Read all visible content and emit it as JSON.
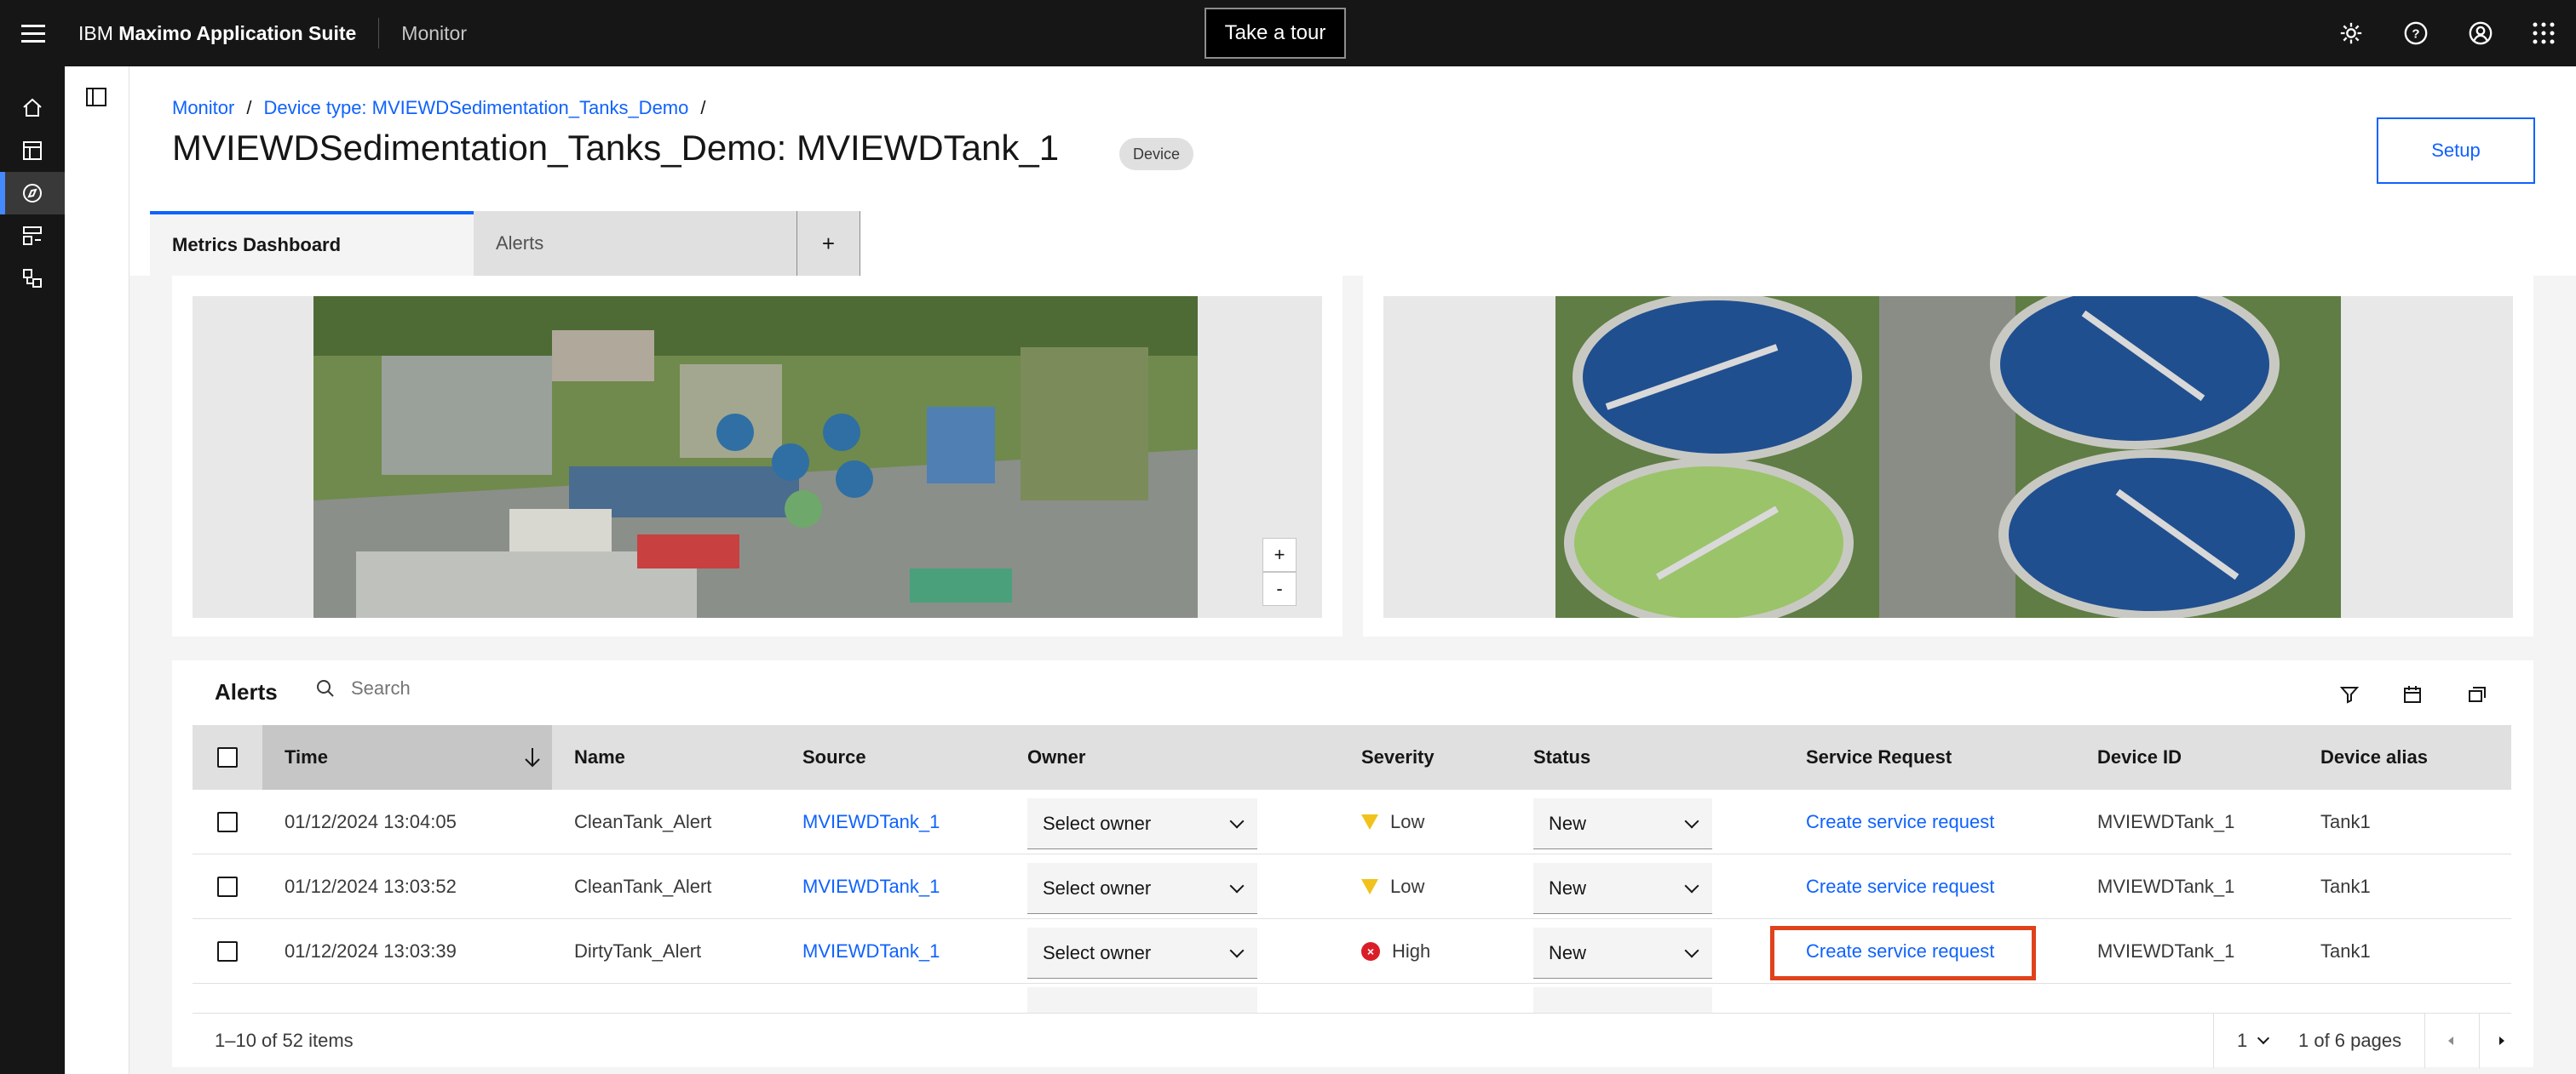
{
  "topbar": {
    "brand_prefix": "IBM",
    "brand_bold": "Maximo Application Suite",
    "product": "Monitor",
    "tour_label": "Take a tour",
    "icons": [
      "gear-icon",
      "help-icon",
      "user-avatar-icon",
      "app-switcher-icon"
    ]
  },
  "sidenav": {
    "items": [
      "home-icon",
      "dashboard-icon",
      "monitor-icon",
      "setup-icon",
      "devices-icon"
    ],
    "active_index": 2
  },
  "breadcrumb": {
    "root": "Monitor",
    "device_type": "Device type: MVIEWDSedimentation_Tanks_Demo",
    "separator": "/"
  },
  "page": {
    "title": "MVIEWDSedimentation_Tanks_Demo: MVIEWDTank_1",
    "tag": "Device",
    "setup_label": "Setup"
  },
  "tabs": {
    "metrics": "Metrics Dashboard",
    "alerts": "Alerts",
    "add": "+"
  },
  "zoom": {
    "in": "+",
    "out": "-"
  },
  "alerts": {
    "title": "Alerts",
    "search_placeholder": "Search",
    "columns": [
      "Time",
      "Name",
      "Source",
      "Owner",
      "Severity",
      "Status",
      "Service Request",
      "Device ID",
      "Device alias"
    ],
    "rows": [
      {
        "time": "01/12/2024 13:04:05",
        "name": "CleanTank_Alert",
        "source": "MVIEWDTank_1",
        "owner": "Select owner",
        "severity": "Low",
        "status": "New",
        "service_request": "Create service request",
        "device_id": "MVIEWDTank_1",
        "alias": "Tank1"
      },
      {
        "time": "01/12/2024 13:03:52",
        "name": "CleanTank_Alert",
        "source": "MVIEWDTank_1",
        "owner": "Select owner",
        "severity": "Low",
        "status": "New",
        "service_request": "Create service request",
        "device_id": "MVIEWDTank_1",
        "alias": "Tank1"
      },
      {
        "time": "01/12/2024 13:03:39",
        "name": "DirtyTank_Alert",
        "source": "MVIEWDTank_1",
        "owner": "Select owner",
        "severity": "High",
        "status": "New",
        "service_request": "Create service request",
        "device_id": "MVIEWDTank_1",
        "alias": "Tank1"
      }
    ],
    "footer": {
      "range": "1–10 of 52 items",
      "page": "1",
      "pages": "1 of 6 pages"
    }
  },
  "colors": {
    "accent": "#0f62fe",
    "shell": "#161616",
    "severity_low": "#f1c21b",
    "severity_high": "#da1e28",
    "highlight": "#e0421b"
  }
}
